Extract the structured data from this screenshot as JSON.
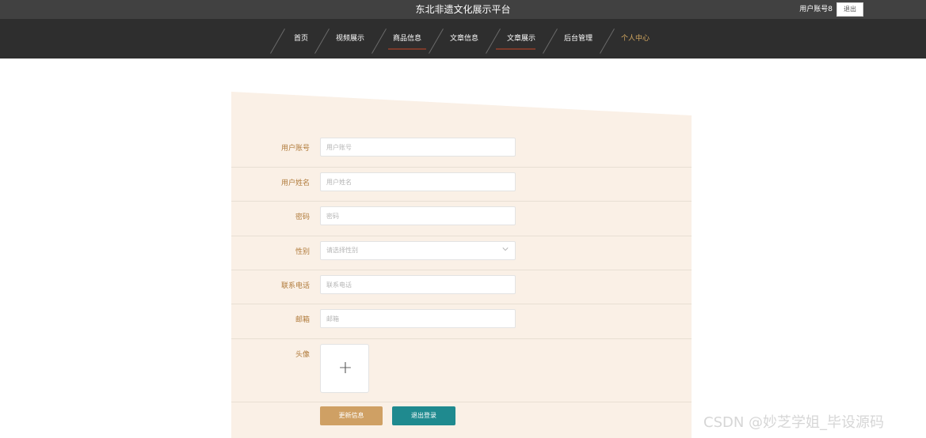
{
  "header": {
    "site_title": "东北非遗文化展示平台",
    "user_account": "用户账号8",
    "logout_label": "退出"
  },
  "nav": {
    "items": [
      {
        "label": "首页",
        "active": false
      },
      {
        "label": "视频展示",
        "active": false
      },
      {
        "label": "商品信息",
        "active": false
      },
      {
        "label": "文章信息",
        "active": false
      },
      {
        "label": "文章展示",
        "active": false
      },
      {
        "label": "后台管理",
        "active": false
      },
      {
        "label": "个人中心",
        "active": true
      }
    ]
  },
  "form": {
    "account": {
      "label": "用户账号",
      "placeholder": "用户账号"
    },
    "name": {
      "label": "用户姓名",
      "placeholder": "用户姓名"
    },
    "password": {
      "label": "密码",
      "placeholder": "密码"
    },
    "gender": {
      "label": "性别",
      "placeholder": "请选择性别"
    },
    "phone": {
      "label": "联系电话",
      "placeholder": "联系电话"
    },
    "email": {
      "label": "邮箱",
      "placeholder": "邮箱"
    },
    "avatar": {
      "label": "头像",
      "icon": "plus-icon"
    },
    "buttons": {
      "update": "更新信息",
      "logout": "退出登录"
    }
  },
  "colors": {
    "topbar": "#414141",
    "navbar": "#2e2e2e",
    "panel": "#faf0e6",
    "accent_gold": "#cfa064",
    "accent_teal": "#1f8a8f",
    "label_brown": "#b07a3a"
  },
  "watermark": "CSDN @妙芝学姐_毕设源码"
}
